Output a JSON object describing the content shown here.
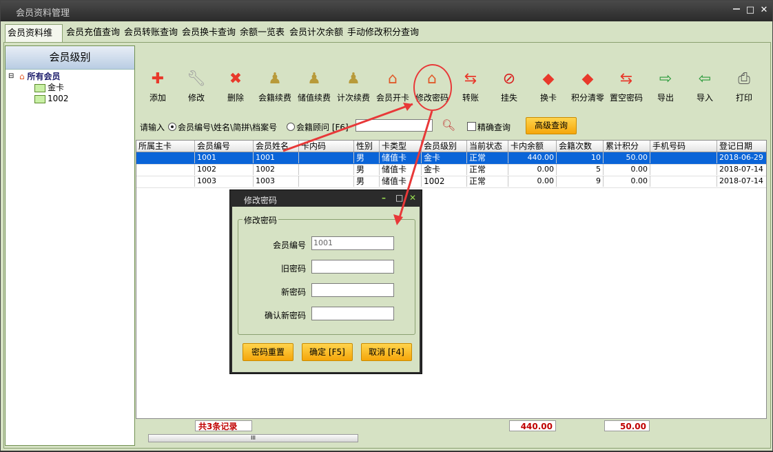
{
  "window": {
    "title": "会员资料管理",
    "controls": [
      "－",
      "□",
      "✕"
    ]
  },
  "tabs": [
    "会员资料维护",
    "会员充值查询",
    "会员转账查询",
    "会员换卡查询",
    "余额一览表",
    "会员计次余额",
    "手动修改积分查询"
  ],
  "left_panel": {
    "header": "会员级别",
    "tree_root": "所有会员",
    "tree_items": [
      "金卡",
      "1002"
    ]
  },
  "toolbar": [
    {
      "label": "添加",
      "icon": "add-icon",
      "color": "#e8392b"
    },
    {
      "label": "修改",
      "icon": "wrench-icon",
      "color": "#a0a0a0"
    },
    {
      "label": "删除",
      "icon": "delete-icon",
      "color": "#e8392b"
    },
    {
      "label": "会籍续费",
      "icon": "pawn-icon",
      "color": "#b89a3a"
    },
    {
      "label": "储值续费",
      "icon": "pawn-icon",
      "color": "#b89a3a"
    },
    {
      "label": "计次续费",
      "icon": "pawn-icon",
      "color": "#b89a3a"
    },
    {
      "label": "会员开卡",
      "icon": "house-icon",
      "color": "#e05a2a"
    },
    {
      "label": "修改密码",
      "icon": "house-icon",
      "color": "#e05a2a"
    },
    {
      "label": "转账",
      "icon": "transfer-icon",
      "color": "#e8392b"
    },
    {
      "label": "挂失",
      "icon": "no-entry-icon",
      "color": "#d91c1c"
    },
    {
      "label": "换卡",
      "icon": "diamond-icon",
      "color": "#e8392b"
    },
    {
      "label": "积分清零",
      "icon": "diamond-icon",
      "color": "#e8392b"
    },
    {
      "label": "置空密码",
      "icon": "transfer-icon",
      "color": "#e8392b"
    },
    {
      "label": "导出",
      "icon": "export-icon",
      "color": "#2a9a3a"
    },
    {
      "label": "导入",
      "icon": "import-icon",
      "color": "#2a9a3a"
    },
    {
      "label": "打印",
      "icon": "printer-icon",
      "color": "#555555"
    }
  ],
  "search": {
    "prompt": "请输入",
    "option1": "会员编号\\姓名\\简拼\\档案号",
    "option2": "会籍顾问 [F6]",
    "exact_label": "精确查询",
    "advanced_button": "高级查询"
  },
  "grid": {
    "columns": [
      "所属主卡",
      "会员编号",
      "会员姓名",
      "卡内码",
      "性别",
      "卡类型",
      "会员级别",
      "当前状态",
      "卡内余额",
      "会籍次数",
      "累计积分",
      "手机号码",
      "登记日期"
    ],
    "rows": [
      [
        "",
        "1001",
        "1001",
        "",
        "男",
        "储值卡",
        "金卡",
        "正常",
        "440.00",
        "10",
        "50.00",
        "",
        "2018-06-29"
      ],
      [
        "",
        "1002",
        "1002",
        "",
        "男",
        "储值卡",
        "金卡",
        "正常",
        "0.00",
        "5",
        "0.00",
        "",
        "2018-07-14"
      ],
      [
        "",
        "1003",
        "1003",
        "",
        "男",
        "储值卡",
        "1002",
        "正常",
        "0.00",
        "9",
        "0.00",
        "",
        "2018-07-14"
      ]
    ]
  },
  "footer": {
    "count": "共3条记录",
    "balance_total": "440.00",
    "points_total": "50.00",
    "scroll_grip": "III"
  },
  "dialog": {
    "title": "修改密码",
    "controls": [
      "–",
      "□",
      "✕"
    ],
    "group_title": "修改密码",
    "fields": [
      {
        "label": "会员编号",
        "value": "1001"
      },
      {
        "label": "旧密码",
        "value": ""
      },
      {
        "label": "新密码",
        "value": ""
      },
      {
        "label": "确认新密码",
        "value": ""
      }
    ],
    "buttons": [
      "密码重置",
      "确定 [F5]",
      "取消 [F4]"
    ]
  },
  "colors": {
    "accent_red": "#e83838",
    "selected_row": "#0a64d8",
    "panel_bg": "#d6e2c4"
  }
}
